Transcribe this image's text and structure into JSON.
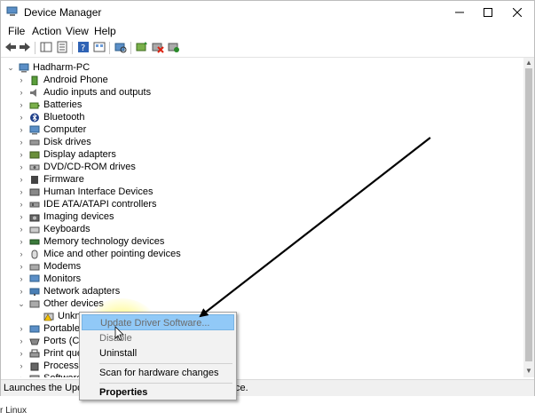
{
  "window": {
    "title": "Device Manager"
  },
  "menu": [
    "File",
    "Action",
    "View",
    "Help"
  ],
  "tree": {
    "root": "Hadharm-PC",
    "categories": [
      {
        "label": "Android Phone",
        "icon": "phone-icon"
      },
      {
        "label": "Audio inputs and outputs",
        "icon": "speaker-icon"
      },
      {
        "label": "Batteries",
        "icon": "battery-icon"
      },
      {
        "label": "Bluetooth",
        "icon": "bluetooth-icon"
      },
      {
        "label": "Computer",
        "icon": "computer-icon"
      },
      {
        "label": "Disk drives",
        "icon": "disk-drive-icon"
      },
      {
        "label": "Display adapters",
        "icon": "display-adapter-icon"
      },
      {
        "label": "DVD/CD-ROM drives",
        "icon": "dvd-drive-icon"
      },
      {
        "label": "Firmware",
        "icon": "firmware-icon"
      },
      {
        "label": "Human Interface Devices",
        "icon": "hid-icon"
      },
      {
        "label": "IDE ATA/ATAPI controllers",
        "icon": "ide-controller-icon"
      },
      {
        "label": "Imaging devices",
        "icon": "camera-icon"
      },
      {
        "label": "Keyboards",
        "icon": "keyboard-icon"
      },
      {
        "label": "Memory technology devices",
        "icon": "memory-icon"
      },
      {
        "label": "Mice and other pointing devices",
        "icon": "mouse-icon"
      },
      {
        "label": "Modems",
        "icon": "modem-icon"
      },
      {
        "label": "Monitors",
        "icon": "monitor-icon"
      },
      {
        "label": "Network adapters",
        "icon": "network-icon"
      },
      {
        "label": "Other devices",
        "icon": "other-devices-icon"
      }
    ],
    "other_child": "Unkn",
    "after": [
      {
        "label": "Portable",
        "icon": "portable-device-icon"
      },
      {
        "label": "Ports (CO",
        "icon": "port-icon"
      },
      {
        "label": "Print que",
        "icon": "printer-icon"
      },
      {
        "label": "Processo",
        "icon": "processor-icon"
      },
      {
        "label": "Software",
        "icon": "software-icon"
      }
    ]
  },
  "context_menu": {
    "update": "Update Driver Software...",
    "disable": "Disable",
    "uninstall": "Uninstall",
    "scan": "Scan for hardware changes",
    "properties": "Properties"
  },
  "status": {
    "left": "Launches the Update",
    "right": "ce."
  },
  "footer_text": "r Linux",
  "colors": {
    "highlight": "#91c9f7",
    "arrow": "#000000",
    "glow": "#fffa78"
  }
}
